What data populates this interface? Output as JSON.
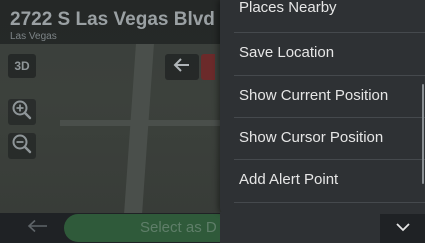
{
  "header": {
    "address": "2722 S Las Vegas Blvd",
    "city": "Las Vegas"
  },
  "map_controls": {
    "view_mode_label": "3D",
    "zoom_in_icon": "zoom-in-icon",
    "zoom_out_icon": "zoom-out-icon",
    "back_icon": "arrow-left-icon"
  },
  "menu": {
    "items": [
      {
        "label": "Places Nearby"
      },
      {
        "label": "Save Location"
      },
      {
        "label": "Show Current Position"
      },
      {
        "label": "Show Cursor Position"
      },
      {
        "label": "Add Alert Point"
      }
    ]
  },
  "bottom_bar": {
    "back_icon": "arrow-left-icon",
    "select_label": "Select as D",
    "collapse_icon": "chevron-down-icon"
  },
  "colors": {
    "menu_bg": "#2e3134",
    "menu_text": "#e6e6e6",
    "select_button": "#2f5a3a"
  }
}
